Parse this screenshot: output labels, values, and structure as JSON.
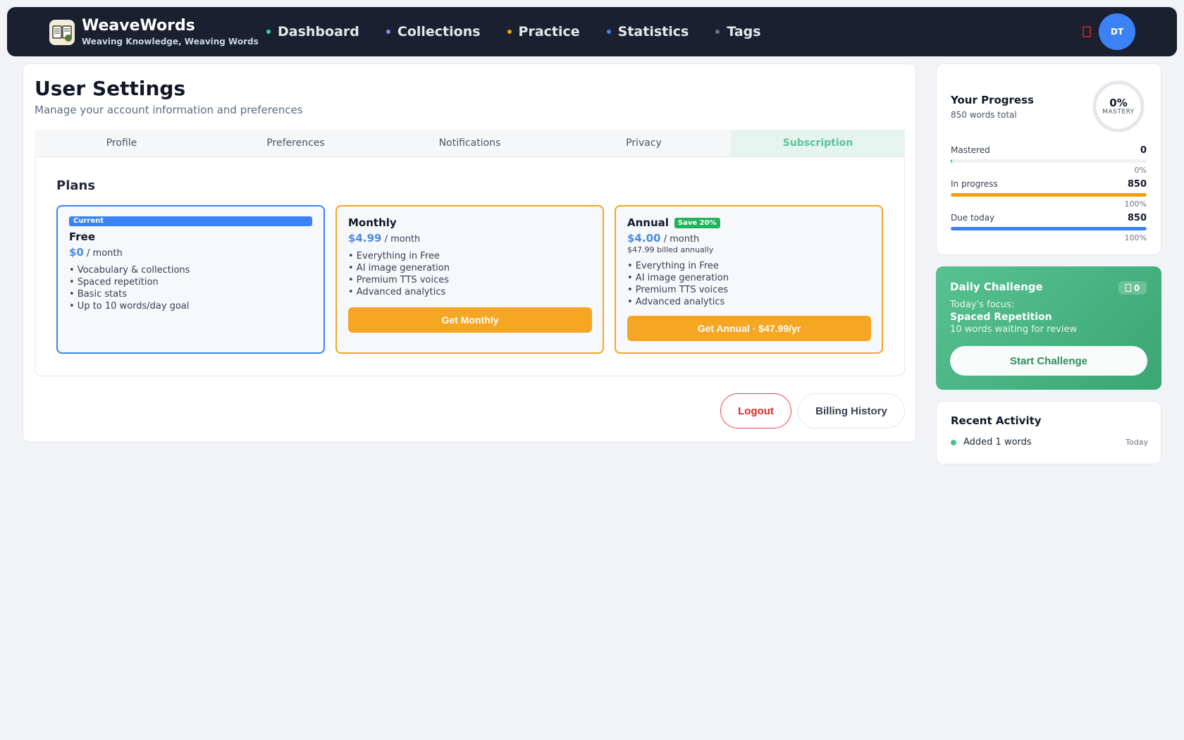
{
  "brand": {
    "name": "WeaveWords",
    "tagline": "Weaving Knowledge, Weaving Words"
  },
  "nav": [
    {
      "label": "Dashboard",
      "dot_color": "#34d399"
    },
    {
      "label": "Collections",
      "dot_color": "#818cf8"
    },
    {
      "label": "Practice",
      "dot_color": "#f59e0b"
    },
    {
      "label": "Statistics",
      "dot_color": "#3b82f6"
    },
    {
      "label": "Tags",
      "dot_color": "#6b7280"
    }
  ],
  "header": {
    "bell_icon": "bell-icon",
    "avatar_initials": "DT"
  },
  "settings": {
    "title": "User Settings",
    "subtitle": "Manage your account information and preferences",
    "tabs": [
      "Profile",
      "Preferences",
      "Notifications",
      "Privacy",
      "Subscription"
    ],
    "active_tab": "Subscription"
  },
  "plans": {
    "title": "Plans",
    "items": [
      {
        "badge": "Current",
        "name": "Free",
        "price": "$0",
        "period": "/ month",
        "features": [
          "• Vocabulary & collections",
          "• Spaced repetition",
          "• Basic stats",
          "• Up to 10 words/day goal"
        ]
      },
      {
        "name": "Monthly",
        "price": "$4.99",
        "period": "/ month",
        "features": [
          "• Everything in Free",
          "• AI image generation",
          "• Premium TTS voices",
          "• Advanced analytics"
        ],
        "button": "Get Monthly"
      },
      {
        "name": "Annual",
        "save_badge": "Save 20%",
        "price": "$4.00",
        "period": "/ month",
        "billed": "$47.99 billed annually",
        "features": [
          "• Everything in Free",
          "• AI image generation",
          "• Premium TTS voices",
          "• Advanced analytics"
        ],
        "button": "Get Annual · $47.99/yr"
      }
    ]
  },
  "actions": {
    "logout": "Logout",
    "billing": "Billing History"
  },
  "progress": {
    "title": "Your Progress",
    "subtitle": "850 words total",
    "ring_value": "0%",
    "ring_label": "MASTERY",
    "mastery_fraction": 0,
    "stats": [
      {
        "label": "Mastered",
        "value": "0",
        "pct": "0%",
        "fraction": 0.0,
        "color": "#22c55e"
      },
      {
        "label": "In progress",
        "value": "850",
        "pct": "100%",
        "fraction": 1.0,
        "color": "#f59e0b"
      },
      {
        "label": "Due today",
        "value": "850",
        "pct": "100%",
        "fraction": 1.0,
        "color": "#3b82f6"
      }
    ]
  },
  "challenge": {
    "title": "Daily Challenge",
    "badge": "0",
    "badge_icon": "flame-icon",
    "focus_label": "Today's focus:",
    "focus": "Spaced Repetition",
    "desc": "10 words waiting for review",
    "button": "Start Challenge"
  },
  "activity": {
    "title": "Recent Activity",
    "items": [
      {
        "text": "Added 1 words",
        "time": "Today"
      }
    ]
  }
}
